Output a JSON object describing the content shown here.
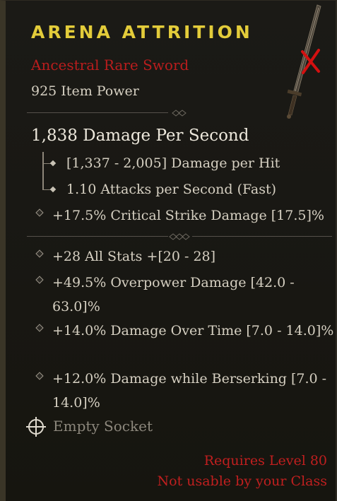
{
  "item": {
    "name": "ARENA ATTRITION",
    "rarity_type": "Ancestral Rare Sword",
    "item_power": "925 Item Power"
  },
  "weapon_stats": {
    "dps": "1,838 Damage Per Second",
    "damage_per_hit": "[1,337 - 2,005] Damage per Hit",
    "attack_speed": "1.10 Attacks per Second (Fast)",
    "implicit": "+17.5% Critical Strike Damage [17.5]%"
  },
  "affixes": [
    "+28 All Stats +[20 - 28]",
    "+49.5% Overpower Damage [42.0 - 63.0]%",
    "+14.0% Damage Over Time [7.0 - 14.0]%",
    "+12.0% Damage while Berserking [7.0 - 14.0]%"
  ],
  "socket": {
    "label": "Empty Socket"
  },
  "requirements": {
    "level": "Requires Level 80",
    "class": "Not usable by your Class"
  },
  "colors": {
    "title": "#e3cc3a",
    "rarity": "#b91d1d",
    "requirement": "#c01f1f",
    "text": "#d6d0c2",
    "muted": "#8c877c"
  },
  "icons": {
    "weapon": "sword-icon",
    "unusable": "red-x-icon",
    "socket": "empty-socket-icon"
  }
}
